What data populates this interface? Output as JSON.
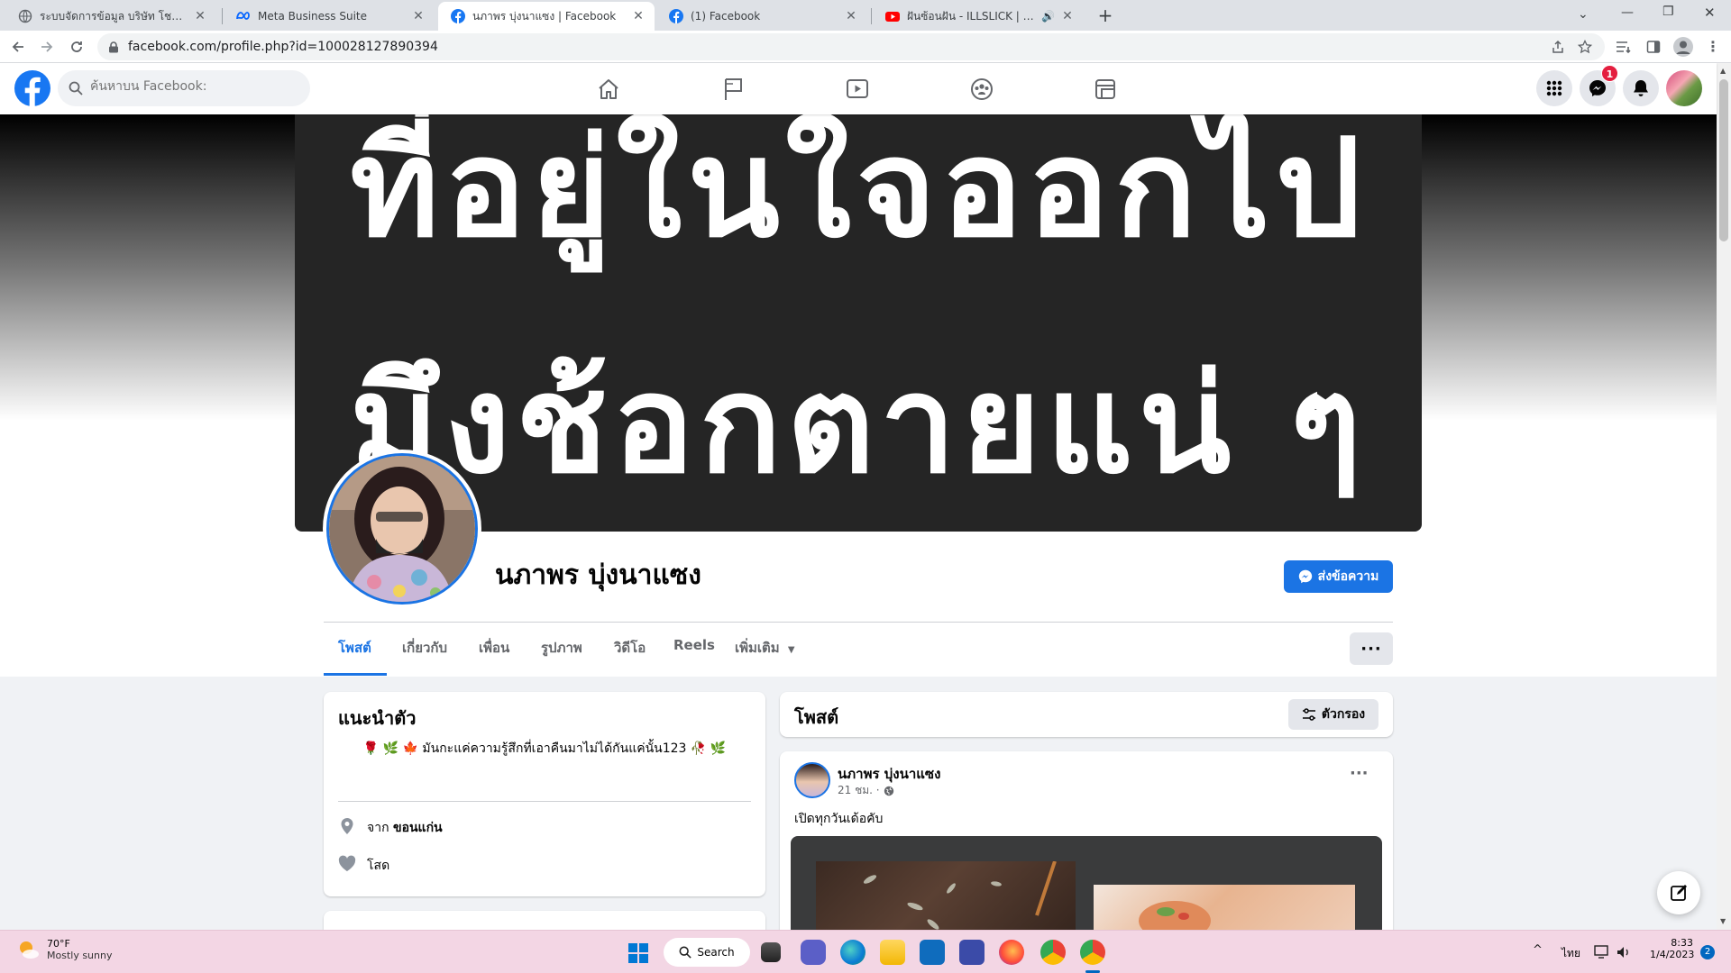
{
  "browser": {
    "tabs": [
      {
        "title": "ระบบจัดการข้อมูล บริษัท โชคลูกน็อต จำกัด",
        "icon": "globe-icon"
      },
      {
        "title": "Meta Business Suite",
        "icon": "meta-icon"
      },
      {
        "title": "นภาพร บุ่งนาแซง | Facebook",
        "icon": "facebook-icon"
      },
      {
        "title": "(1) Facebook",
        "icon": "facebook-icon"
      },
      {
        "title": "ฝันซ้อนฝัน - ILLSLICK | กำลังเล่น",
        "icon": "youtube-icon"
      }
    ],
    "new_tab": "+",
    "url": "facebook.com/profile.php?id=100028127890394"
  },
  "fb": {
    "search_placeholder": "ค้นหาบน Facebook:",
    "messenger_badge": "1",
    "colors": {
      "brand": "#1b74e4",
      "badge": "#e41e3f"
    }
  },
  "profile": {
    "cover_lines": [
      "ที่อยู่ในใจออกไป",
      "มึงช้อกตายแน่ ๆ"
    ],
    "name": "นภาพร บุ่งนาแซง",
    "message_button": "ส่งข้อความ",
    "tabs": [
      "โพสต์",
      "เกี่ยวกับ",
      "เพื่อน",
      "รูปภาพ",
      "วิดีโอ",
      "Reels",
      "เพิ่มเติม"
    ],
    "more_button": "···"
  },
  "intro": {
    "title": "แนะนำตัว",
    "bio": "🌹 🌿 🍁 มันกะแค่ความรู้สึกที่เอาคืนมาไม่ได้กันแค่นั้น123 🥀 🌿",
    "from_prefix": "จาก",
    "from_place": "ขอนแก่น",
    "relationship": "โสด"
  },
  "posts_header": {
    "title": "โพสต์",
    "filter_button": "ตัวกรอง"
  },
  "post": {
    "author": "นภาพร บุ่งนาแซง",
    "time": "21 ชม. ·",
    "text": "เปิดทุกวันเด้อคับ",
    "menu": "···"
  },
  "taskbar": {
    "weather_temp": "70°F",
    "weather_desc": "Mostly sunny",
    "search_label": "Search",
    "lang": "ไทย",
    "time": "8:33",
    "date": "1/4/2023",
    "notif_count": "2"
  }
}
